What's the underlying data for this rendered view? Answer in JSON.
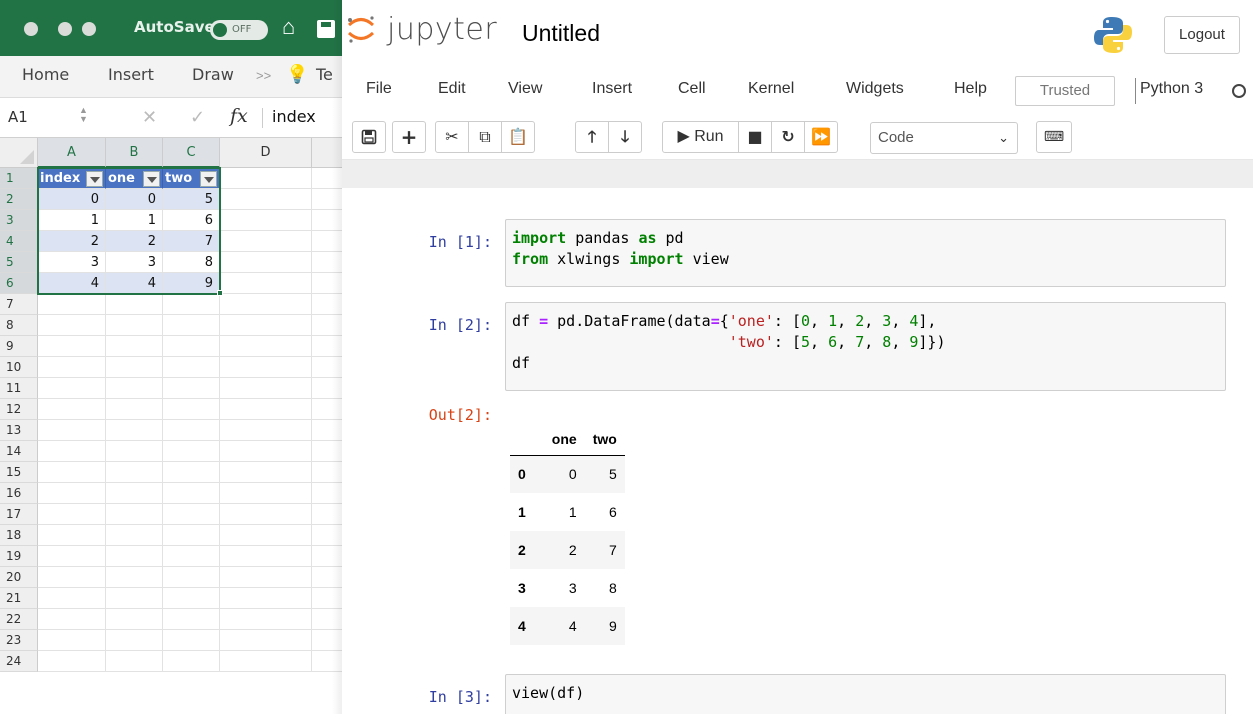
{
  "excel": {
    "autosave_label": "AutoSave",
    "autosave_state": "OFF",
    "ribbon_tabs": [
      "Home",
      "Insert",
      "Draw",
      "Te"
    ],
    "name_box": "A1",
    "formula_value": "index",
    "columns": [
      "A",
      "B",
      "C",
      "D"
    ],
    "row_numbers": [
      "1",
      "2",
      "3",
      "4",
      "5",
      "6",
      "7",
      "8",
      "9",
      "10",
      "11",
      "12",
      "13",
      "14",
      "15",
      "16",
      "17",
      "18",
      "19",
      "20",
      "21",
      "22",
      "23",
      "24"
    ],
    "table_headers": [
      "index",
      "one",
      "two"
    ],
    "table_rows": [
      [
        "0",
        "0",
        "5"
      ],
      [
        "1",
        "1",
        "6"
      ],
      [
        "2",
        "2",
        "7"
      ],
      [
        "3",
        "3",
        "8"
      ],
      [
        "4",
        "4",
        "9"
      ]
    ],
    "colors": {
      "titlebar": "#217346",
      "table_header": "#4a73c3",
      "band": "#dce3f2"
    }
  },
  "jupyter": {
    "logo_text": "jupyter",
    "notebook_title": "Untitled",
    "logout_label": "Logout",
    "menu": [
      "File",
      "Edit",
      "View",
      "Insert",
      "Cell",
      "Kernel",
      "Widgets",
      "Help"
    ],
    "trusted_label": "Trusted",
    "kernel_name": "Python 3",
    "toolbar": {
      "save_icon": "save-icon",
      "run_label": "Run",
      "cell_type": "Code"
    },
    "cells": [
      {
        "prompt": "In [1]:"
      },
      {
        "prompt": "In [2]:",
        "out_prompt": "Out[2]:"
      },
      {
        "prompt": "In [3]:",
        "code": "view(df)"
      }
    ],
    "dataframe": {
      "columns": [
        "one",
        "two"
      ],
      "rows": [
        {
          "index": "0",
          "one": "0",
          "two": "5"
        },
        {
          "index": "1",
          "one": "1",
          "two": "6"
        },
        {
          "index": "2",
          "one": "2",
          "two": "7"
        },
        {
          "index": "3",
          "one": "3",
          "two": "8"
        },
        {
          "index": "4",
          "one": "4",
          "two": "9"
        }
      ]
    }
  }
}
